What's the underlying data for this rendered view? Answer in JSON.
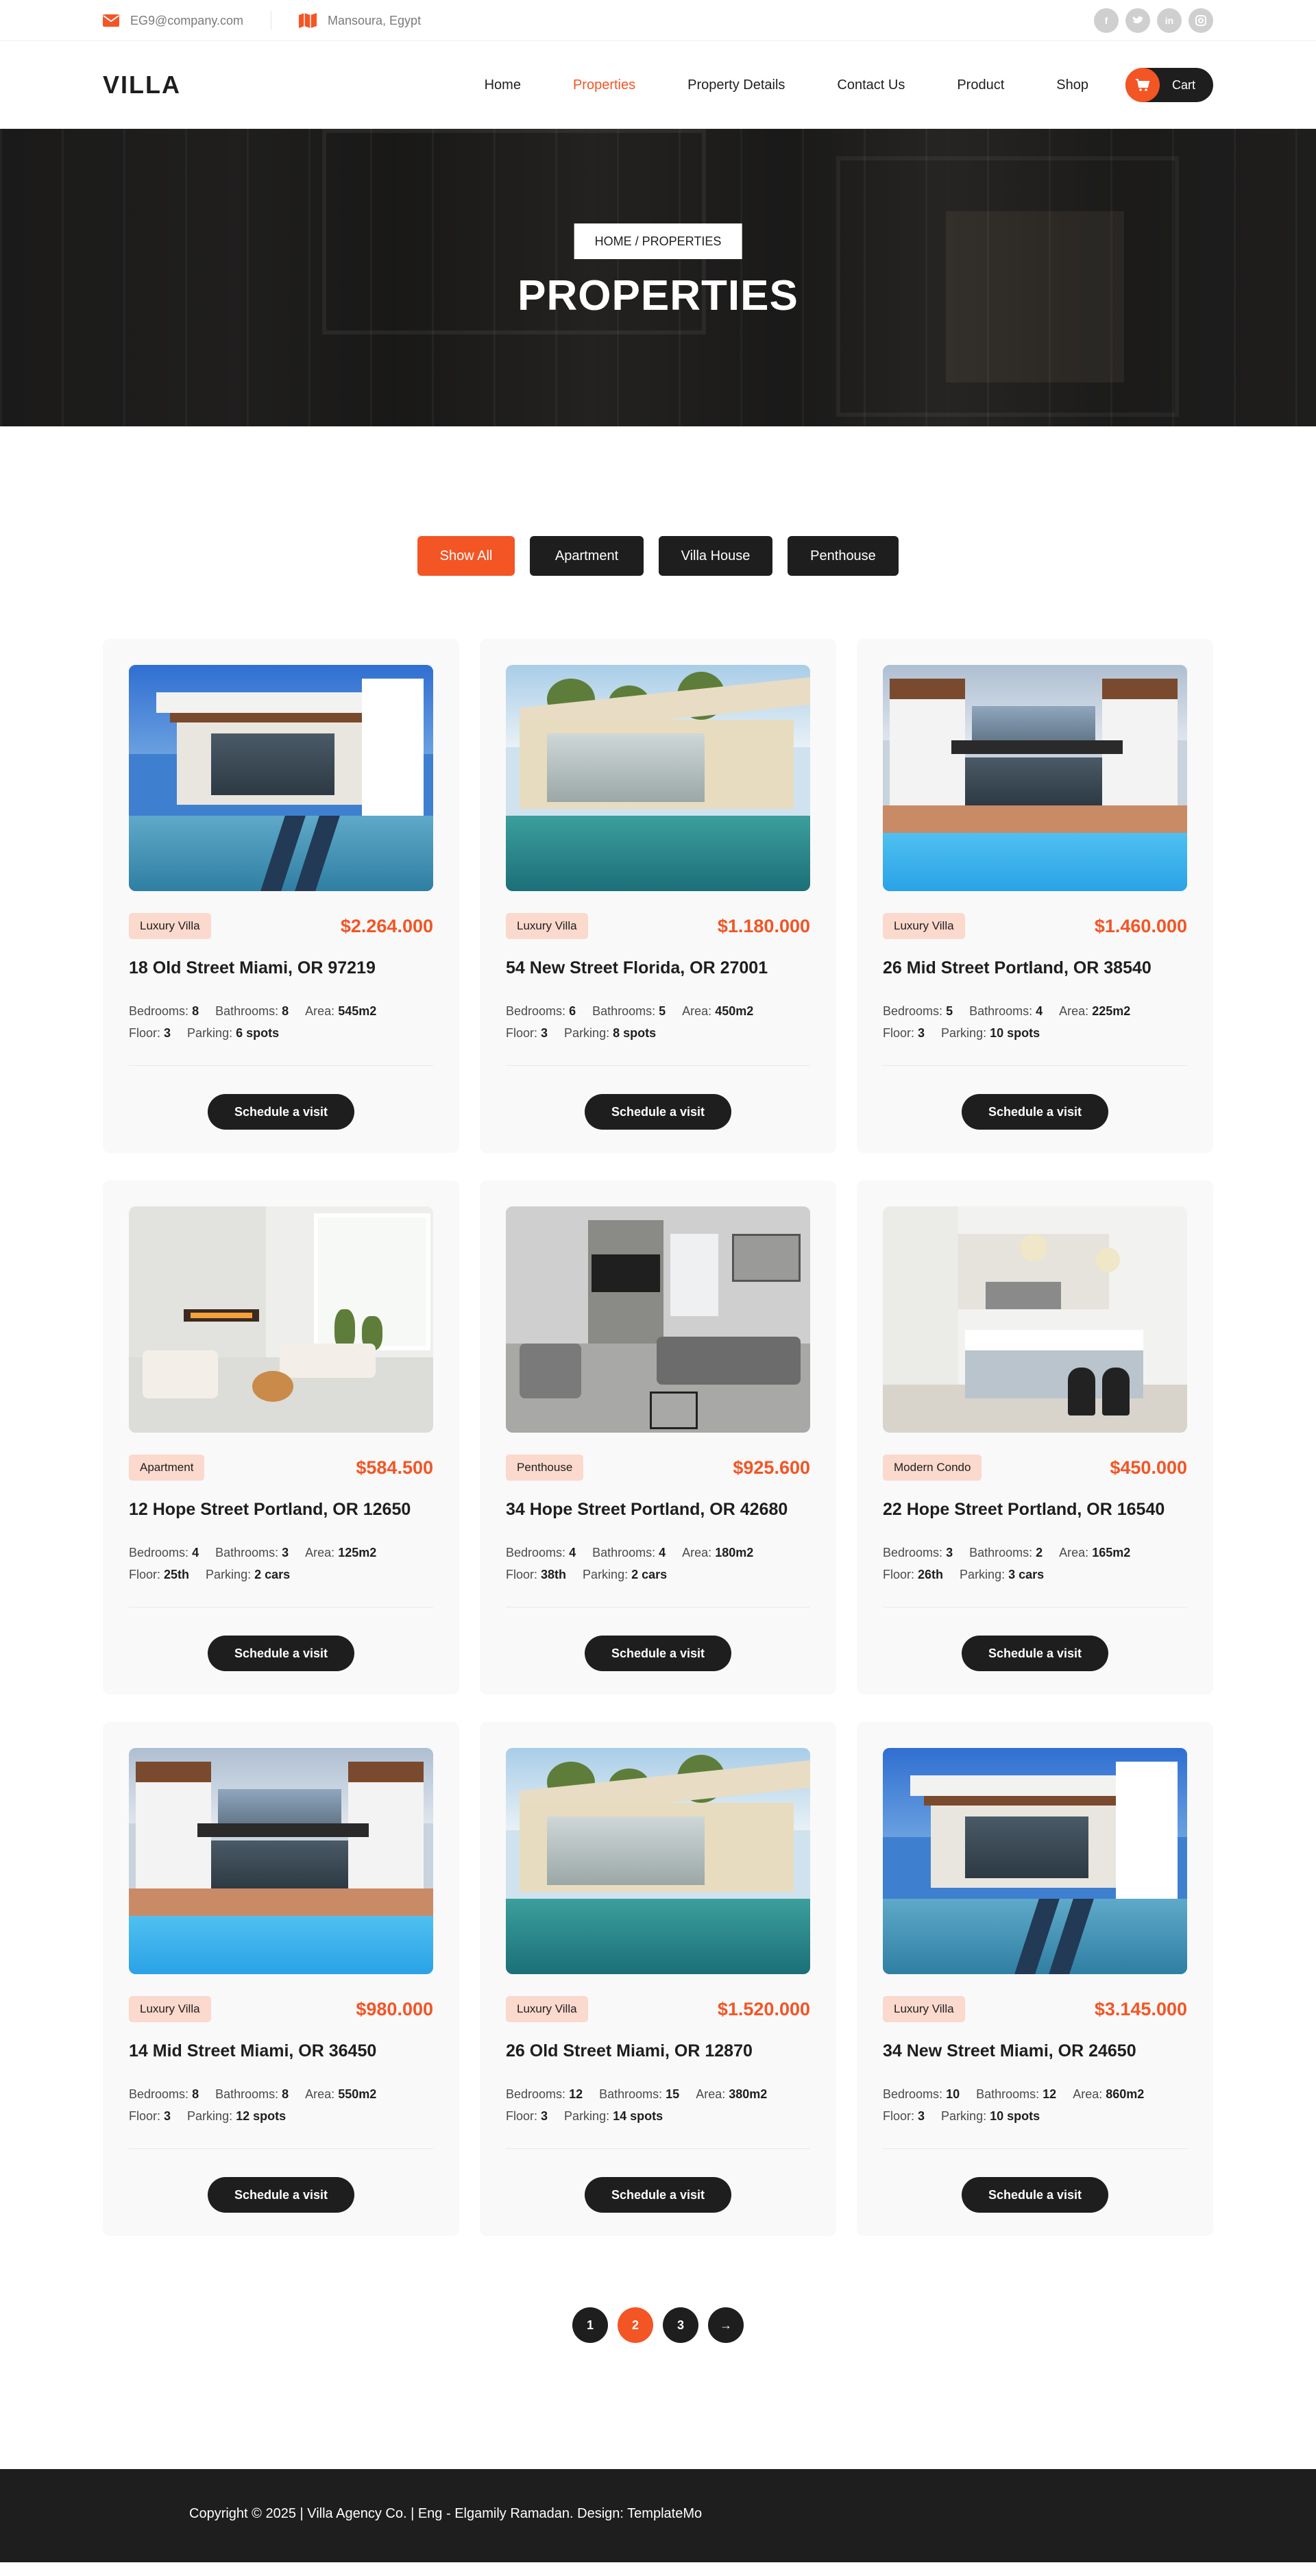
{
  "topbar": {
    "email": "EG9@company.com",
    "location": "Mansoura, Egypt",
    "socials": [
      "facebook-icon",
      "twitter-icon",
      "linkedin-icon",
      "instagram-icon"
    ]
  },
  "header": {
    "logo": "VILLA",
    "nav": [
      {
        "label": "Home",
        "active": false
      },
      {
        "label": "Properties",
        "active": true
      },
      {
        "label": "Property Details",
        "active": false
      },
      {
        "label": "Contact Us",
        "active": false
      },
      {
        "label": "Product",
        "active": false
      },
      {
        "label": "Shop",
        "active": false
      }
    ],
    "cart_label": "Cart"
  },
  "hero": {
    "breadcrumb": "HOME / PROPERTIES",
    "title": "PROPERTIES"
  },
  "filters": [
    {
      "label": "Show All",
      "active": true
    },
    {
      "label": "Apartment",
      "active": false
    },
    {
      "label": "Villa House",
      "active": false
    },
    {
      "label": "Penthouse",
      "active": false
    }
  ],
  "properties": [
    {
      "tag": "Luxury Villa",
      "price": "$2.264.000",
      "title": "18 Old Street Miami, OR 97219",
      "specs": [
        {
          "k": "Bedrooms:",
          "v": "8"
        },
        {
          "k": "Bathrooms:",
          "v": "8"
        },
        {
          "k": "Area:",
          "v": "545m2"
        },
        {
          "k": "Floor:",
          "v": "3"
        },
        {
          "k": "Parking:",
          "v": "6 spots"
        }
      ],
      "image": "villa-pool-a",
      "button": "Schedule a visit"
    },
    {
      "tag": "Luxury Villa",
      "price": "$1.180.000",
      "title": "54 New Street Florida, OR 27001",
      "specs": [
        {
          "k": "Bedrooms:",
          "v": "6"
        },
        {
          "k": "Bathrooms:",
          "v": "5"
        },
        {
          "k": "Area:",
          "v": "450m2"
        },
        {
          "k": "Floor:",
          "v": "3"
        },
        {
          "k": "Parking:",
          "v": "8 spots"
        }
      ],
      "image": "villa-pool-b",
      "button": "Schedule a visit"
    },
    {
      "tag": "Luxury Villa",
      "price": "$1.460.000",
      "title": "26 Mid Street Portland, OR 38540",
      "specs": [
        {
          "k": "Bedrooms:",
          "v": "5"
        },
        {
          "k": "Bathrooms:",
          "v": "4"
        },
        {
          "k": "Area:",
          "v": "225m2"
        },
        {
          "k": "Floor:",
          "v": "3"
        },
        {
          "k": "Parking:",
          "v": "10 spots"
        }
      ],
      "image": "villa-pool-c",
      "button": "Schedule a visit"
    },
    {
      "tag": "Apartment",
      "price": "$584.500",
      "title": "12 Hope Street Portland, OR 12650",
      "specs": [
        {
          "k": "Bedrooms:",
          "v": "4"
        },
        {
          "k": "Bathrooms:",
          "v": "3"
        },
        {
          "k": "Area:",
          "v": "125m2"
        },
        {
          "k": "Floor:",
          "v": "25th"
        },
        {
          "k": "Parking:",
          "v": "2 cars"
        }
      ],
      "image": "living-room-white",
      "button": "Schedule a visit"
    },
    {
      "tag": "Penthouse",
      "price": "$925.600",
      "title": "34 Hope Street Portland, OR 42680",
      "specs": [
        {
          "k": "Bedrooms:",
          "v": "4"
        },
        {
          "k": "Bathrooms:",
          "v": "4"
        },
        {
          "k": "Area:",
          "v": "180m2"
        },
        {
          "k": "Floor:",
          "v": "38th"
        },
        {
          "k": "Parking:",
          "v": "2 cars"
        }
      ],
      "image": "living-room-grey",
      "button": "Schedule a visit"
    },
    {
      "tag": "Modern Condo",
      "price": "$450.000",
      "title": "22 Hope Street Portland, OR 16540",
      "specs": [
        {
          "k": "Bedrooms:",
          "v": "3"
        },
        {
          "k": "Bathrooms:",
          "v": "2"
        },
        {
          "k": "Area:",
          "v": "165m2"
        },
        {
          "k": "Floor:",
          "v": "26th"
        },
        {
          "k": "Parking:",
          "v": "3 cars"
        }
      ],
      "image": "kitchen-white",
      "button": "Schedule a visit"
    },
    {
      "tag": "Luxury Villa",
      "price": "$980.000",
      "title": "14 Mid Street Miami, OR 36450",
      "specs": [
        {
          "k": "Bedrooms:",
          "v": "8"
        },
        {
          "k": "Bathrooms:",
          "v": "8"
        },
        {
          "k": "Area:",
          "v": "550m2"
        },
        {
          "k": "Floor:",
          "v": "3"
        },
        {
          "k": "Parking:",
          "v": "12 spots"
        }
      ],
      "image": "villa-pool-c",
      "button": "Schedule a visit"
    },
    {
      "tag": "Luxury Villa",
      "price": "$1.520.000",
      "title": "26 Old Street Miami, OR 12870",
      "specs": [
        {
          "k": "Bedrooms:",
          "v": "12"
        },
        {
          "k": "Bathrooms:",
          "v": "15"
        },
        {
          "k": "Area:",
          "v": "380m2"
        },
        {
          "k": "Floor:",
          "v": "3"
        },
        {
          "k": "Parking:",
          "v": "14 spots"
        }
      ],
      "image": "villa-pool-b",
      "button": "Schedule a visit"
    },
    {
      "tag": "Luxury Villa",
      "price": "$3.145.000",
      "title": "34 New Street Miami, OR 24650",
      "specs": [
        {
          "k": "Bedrooms:",
          "v": "10"
        },
        {
          "k": "Bathrooms:",
          "v": "12"
        },
        {
          "k": "Area:",
          "v": "860m2"
        },
        {
          "k": "Floor:",
          "v": "3"
        },
        {
          "k": "Parking:",
          "v": "10 spots"
        }
      ],
      "image": "villa-pool-a",
      "button": "Schedule a visit"
    }
  ],
  "pagination": {
    "pages": [
      {
        "label": "1",
        "active": false
      },
      {
        "label": "2",
        "active": true
      },
      {
        "label": "3",
        "active": false
      }
    ],
    "next": "→"
  },
  "footer": {
    "text": "Copyright © 2025 | Villa Agency Co. | Eng - Elgamily Ramadan. Design: TemplateMo"
  },
  "colors": {
    "accent": "#f35525",
    "dark": "#1e1e1e",
    "tag_bg": "#fbd9cd",
    "card_bg": "#f9f9f9"
  }
}
